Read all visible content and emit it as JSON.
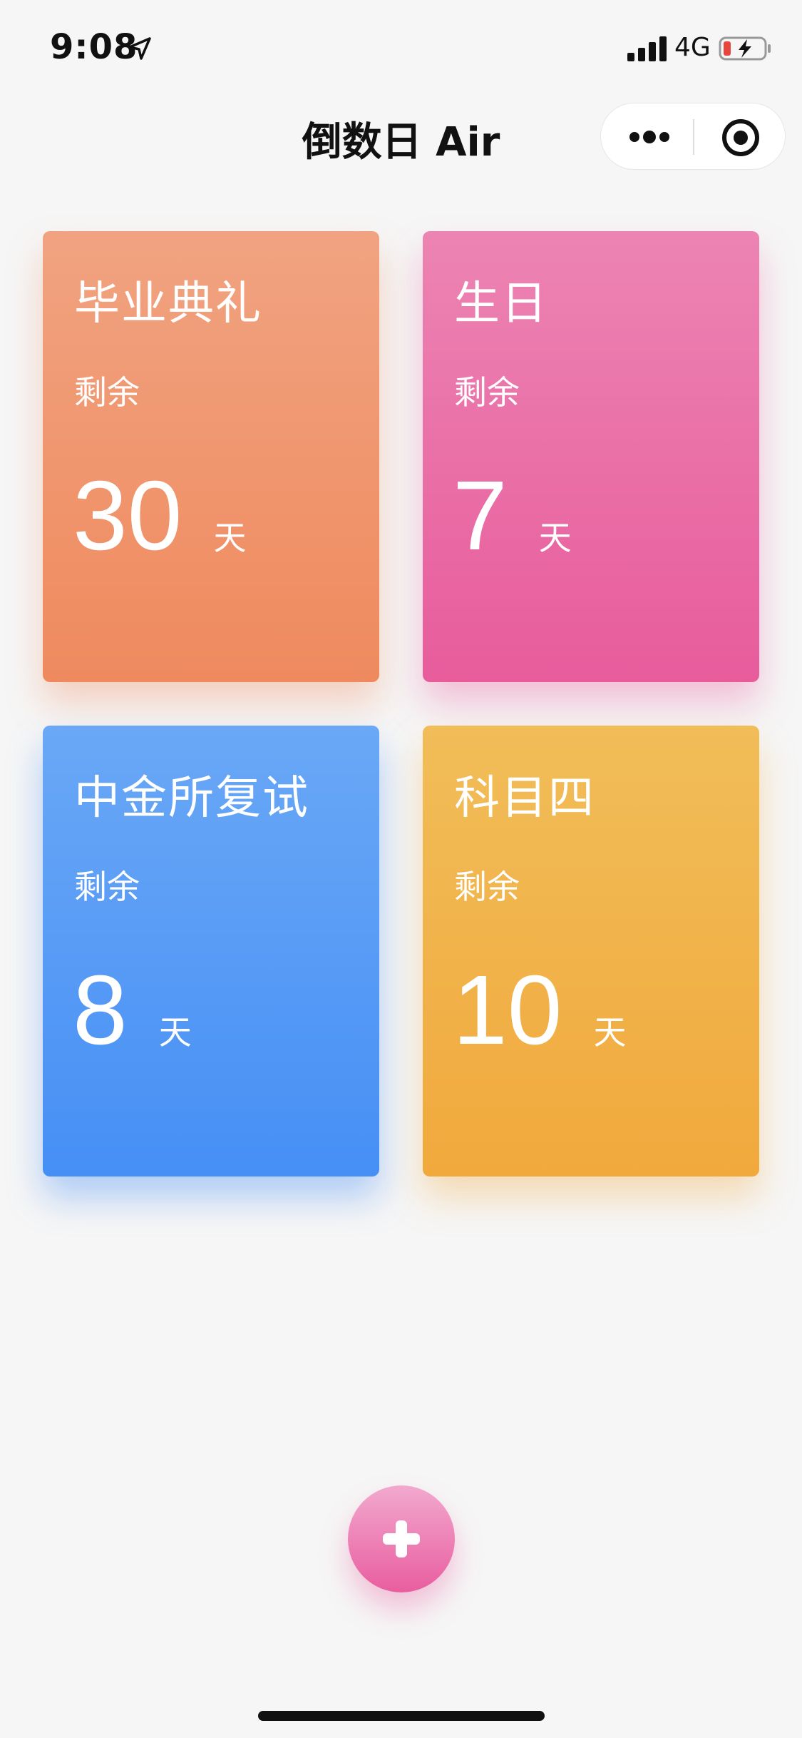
{
  "status_bar": {
    "time": "9:08",
    "network": "4G"
  },
  "nav": {
    "title": "倒数日 Air"
  },
  "cards": [
    {
      "title": "毕业典礼",
      "remaining_label": "剩余",
      "days": "30",
      "unit": "天",
      "color": "#ef8a5e"
    },
    {
      "title": "生日",
      "remaining_label": "剩余",
      "days": "7",
      "unit": "天",
      "color": "#e85c9c"
    },
    {
      "title": "中金所复试",
      "remaining_label": "剩余",
      "days": "8",
      "unit": "天",
      "color": "#468ff5"
    },
    {
      "title": "科目四",
      "remaining_label": "剩余",
      "days": "10",
      "unit": "天",
      "color": "#f1a93d"
    }
  ],
  "icons": {
    "location": "location-arrow-icon",
    "signal": "cellular-signal-icon",
    "battery": "battery-charging-icon",
    "more": "more-dots-icon",
    "close": "close-miniprogram-icon",
    "add": "plus-icon"
  }
}
